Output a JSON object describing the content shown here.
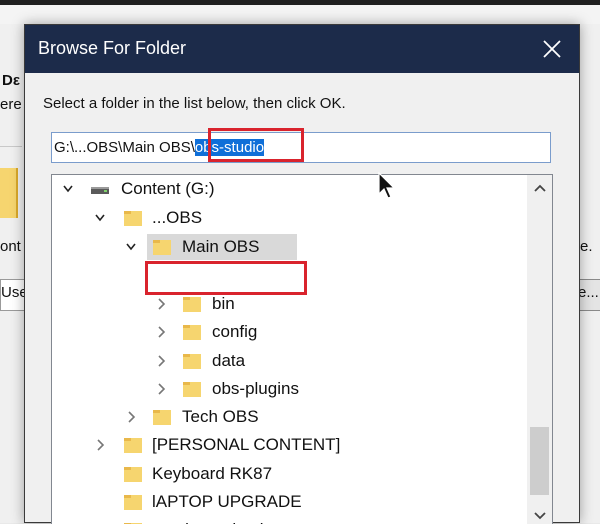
{
  "background": {
    "fragment_de": "Dε",
    "fragment_ere": "ere",
    "fragment_cont": "ont",
    "fragment_use": "Use",
    "fragment_e_dot": "e.",
    "fragment_e_dots": "e..."
  },
  "dialog": {
    "title": "Browse For Folder",
    "instruction": "Select a folder in the list below, then click OK.",
    "path_prefix": "G:\\...OBS\\Main OBS\\",
    "path_selected": "obs-studio",
    "close_icon": "close-icon"
  },
  "tree": {
    "items": [
      {
        "label": "Content (G:)",
        "icon": "drive-icon",
        "state": "expanded"
      },
      {
        "label": "...OBS",
        "icon": "folder-icon",
        "state": "expanded"
      },
      {
        "label": "Main OBS",
        "icon": "folder-icon",
        "state": "expanded",
        "selected": true
      },
      {
        "label": "bin",
        "icon": "folder-icon",
        "state": "collapsed"
      },
      {
        "label": "config",
        "icon": "folder-icon",
        "state": "collapsed"
      },
      {
        "label": "data",
        "icon": "folder-icon",
        "state": "collapsed"
      },
      {
        "label": "obs-plugins",
        "icon": "folder-icon",
        "state": "collapsed"
      },
      {
        "label": "Tech OBS",
        "icon": "folder-icon",
        "state": "collapsed"
      },
      {
        "label": "[PERSONAL CONTENT]",
        "icon": "folder-icon",
        "state": "collapsed"
      },
      {
        "label": "Keyboard RK87",
        "icon": "folder-icon",
        "state": "none"
      },
      {
        "label": "lAPTOP UPGRADE",
        "icon": "folder-icon",
        "state": "none"
      },
      {
        "label": "monitor unboxing",
        "icon": "folder-icon",
        "state": "none"
      }
    ]
  },
  "colors": {
    "titlebar": "#1c2b4a",
    "selection": "#0f6fd8",
    "highlight_box": "#d9232d",
    "folder": "#f6d56f"
  }
}
